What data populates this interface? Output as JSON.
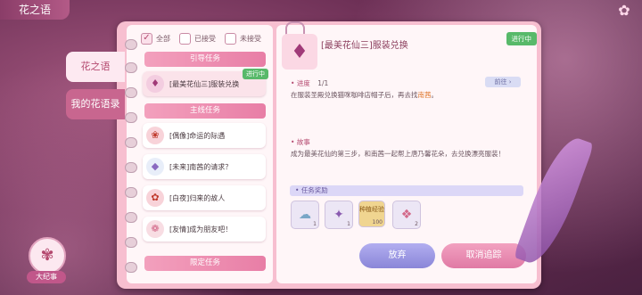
{
  "header": {
    "title": "花之语",
    "corner_icon": "flower-icon"
  },
  "side_tabs": {
    "active": "花之语",
    "inactive": "我的花语录"
  },
  "filters": [
    {
      "label": "全部",
      "checked": true
    },
    {
      "label": "已接受",
      "checked": false
    },
    {
      "label": "未接受",
      "checked": false
    }
  ],
  "sections": {
    "guide": "引导任务",
    "main": "主线任务",
    "limited": "限定任务"
  },
  "quests": {
    "selected": {
      "label": "[最美花仙三]服装兑换",
      "badge": "进行中"
    },
    "items": [
      {
        "label": "[偶像]命运的际遇"
      },
      {
        "label": "[未来]南茜的请求？"
      },
      {
        "label": "[白夜]归来的故人"
      },
      {
        "label": "[友情]成为朋友吧！"
      }
    ]
  },
  "detail": {
    "title": "[最美花仙三]服装兑换",
    "status": "进行中",
    "progress_label": "进度",
    "progress_value": "1/1",
    "progress_fraction": 1.0,
    "goto": "前往",
    "progress_text_pre": "在服装圣殿兑换猫咪咖啡店帽子后，再去找",
    "progress_text_name": "南茜",
    "progress_text_post": "。",
    "story_label": "故事",
    "story_text": "成为最美花仙的第三步，和南茜一起帮上唐乃馨花朵，去兑换漂亮服装！",
    "reward_label": "任务奖励",
    "rewards": [
      {
        "icon": "cloth-icon",
        "count": "1"
      },
      {
        "icon": "bow-icon",
        "count": "1"
      },
      {
        "icon": "medal-icon",
        "count": "100"
      },
      {
        "icon": "gem-icon",
        "count": "2"
      }
    ],
    "reward_item3_text": "种植经验"
  },
  "buttons": {
    "give_up": "放弃",
    "untrack": "取消追踪"
  },
  "emblem": {
    "label": "大纪事"
  },
  "colors": {
    "accent": "#e87ea6",
    "status_green": "#58b96a",
    "button_purple": "#8a86d8"
  }
}
